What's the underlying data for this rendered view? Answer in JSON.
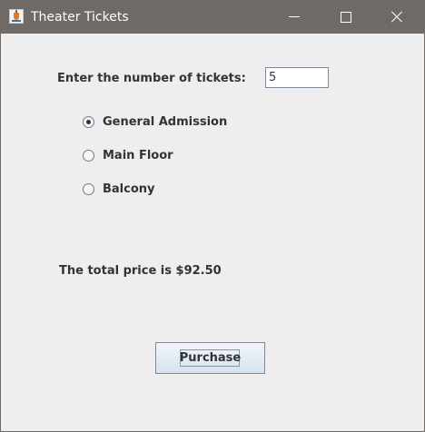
{
  "window": {
    "title": "Theater Tickets",
    "controls": {
      "minimize_icon": "minimize-icon",
      "maximize_icon": "maximize-icon",
      "close_icon": "close-icon"
    },
    "app_icon": "java-cup-icon"
  },
  "form": {
    "tickets_prompt": "Enter the number of tickets:",
    "tickets_value": "5",
    "seating_options": [
      {
        "label": "General Admission",
        "selected": true
      },
      {
        "label": "Main Floor",
        "selected": false
      },
      {
        "label": "Balcony",
        "selected": false
      }
    ],
    "total_text": "The total price is $92.50",
    "purchase_label": "Purchase"
  },
  "colors": {
    "titlebar": "#6f6a66",
    "window_bg": "#eeeeee",
    "text": "#333333"
  }
}
